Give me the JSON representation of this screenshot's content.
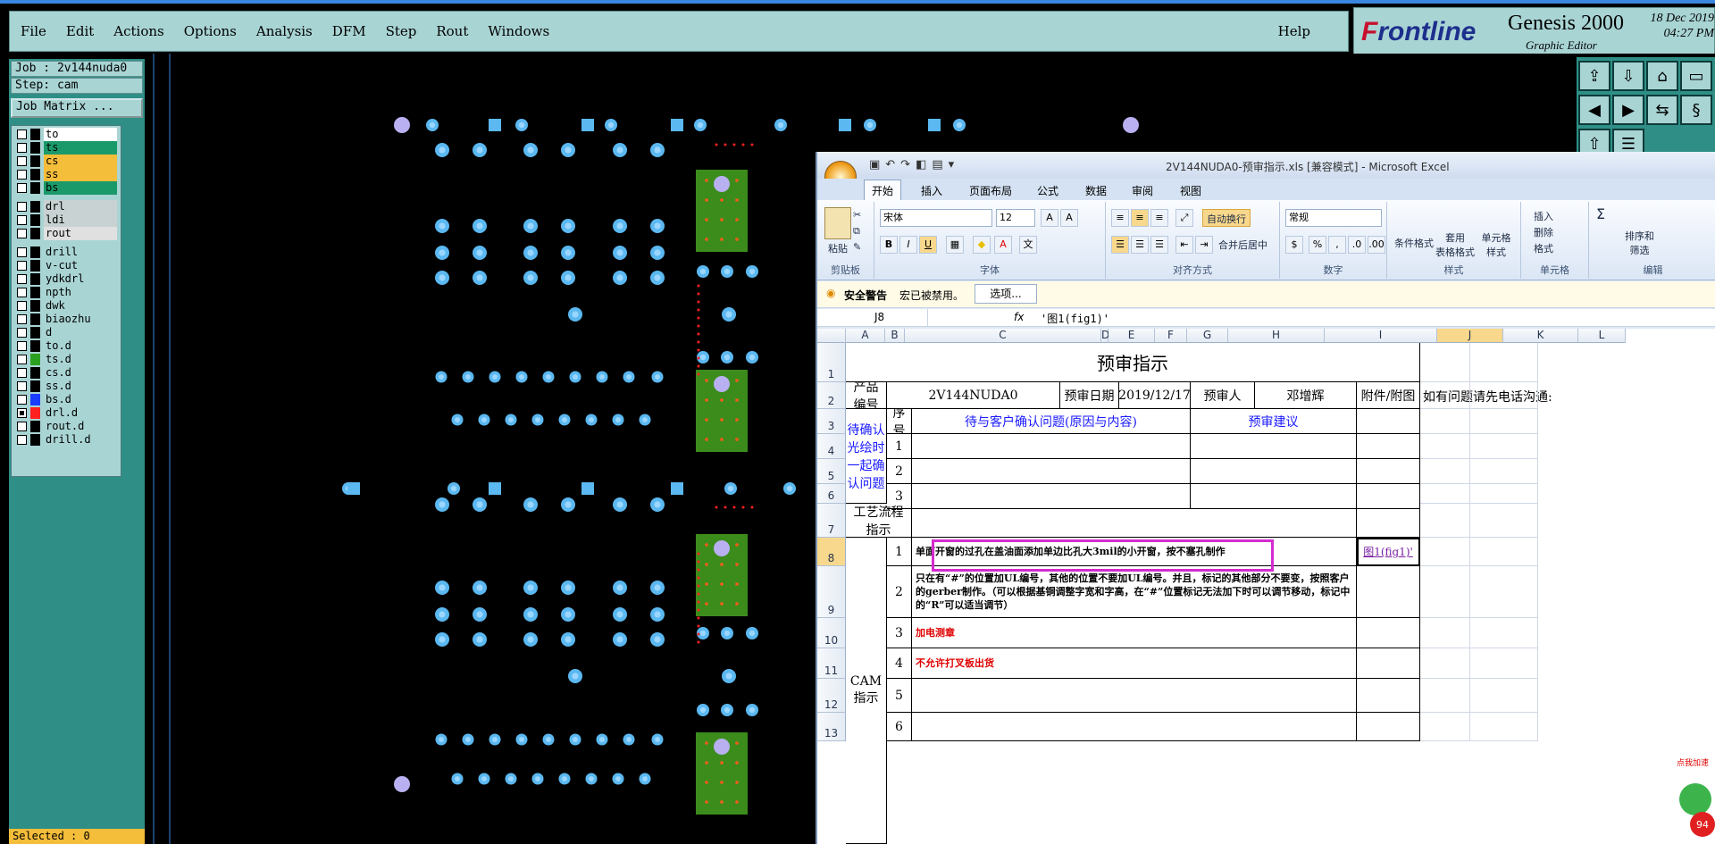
{
  "menu": [
    "File",
    "Edit",
    "Actions",
    "Options",
    "Analysis",
    "DFM",
    "Step",
    "Rout",
    "Windows"
  ],
  "help": "Help",
  "brand": {
    "logo_a": "F",
    "logo_b": "rontline",
    "product": "Genesis 2000",
    "subtitle": "Graphic Editor",
    "date": "18 Dec 2019",
    "time": "04:27 PM"
  },
  "job": {
    "job_label": "Job : 2v144nuda0",
    "step_label": "Step: cam",
    "matrix_button": "Job Matrix ..."
  },
  "layers": [
    {
      "name": "to",
      "color": "#ffffff",
      "swatch": "#000000"
    },
    {
      "name": "ts",
      "color": "#1a9a6a",
      "swatch": "#000000"
    },
    {
      "name": "cs",
      "color": "#f4bd3a",
      "swatch": "#000000"
    },
    {
      "name": "ss",
      "color": "#f4bd3a",
      "swatch": "#000000"
    },
    {
      "name": "bs",
      "color": "#1a9a6a",
      "swatch": "#000000"
    },
    {
      "name": "drl",
      "color": "#c9d2d2",
      "swatch": "#000000"
    },
    {
      "name": "ldi",
      "color": "#c9d2d2",
      "swatch": "#000000"
    },
    {
      "name": "rout",
      "color": "#e0e0e0",
      "swatch": "#000000"
    },
    {
      "name": "drill",
      "color": "#a9d4d4",
      "swatch": "#000000"
    },
    {
      "name": "v-cut",
      "color": "#a9d4d4",
      "swatch": "#000000"
    },
    {
      "name": "ydkdrl",
      "color": "#a9d4d4",
      "swatch": "#000000"
    },
    {
      "name": "npth",
      "color": "#a9d4d4",
      "swatch": "#000000"
    },
    {
      "name": "dwk",
      "color": "#a9d4d4",
      "swatch": "#000000"
    },
    {
      "name": "biaozhu",
      "color": "#a9d4d4",
      "swatch": "#000000"
    },
    {
      "name": "d",
      "color": "#a9d4d4",
      "swatch": "#000000"
    },
    {
      "name": "to.d",
      "color": "#a9d4d4",
      "swatch": "#000000"
    },
    {
      "name": "ts.d",
      "color": "#a9d4d4",
      "swatch": "#2aa020"
    },
    {
      "name": "cs.d",
      "color": "#a9d4d4",
      "swatch": "#000000"
    },
    {
      "name": "ss.d",
      "color": "#a9d4d4",
      "swatch": "#000000"
    },
    {
      "name": "bs.d",
      "color": "#a9d4d4",
      "swatch": "#1a3cff"
    },
    {
      "name": "drl.d",
      "color": "#a9d4d4",
      "swatch": "#ff2020"
    },
    {
      "name": "rout.d",
      "color": "#a9d4d4",
      "swatch": "#000000"
    },
    {
      "name": "drill.d",
      "color": "#a9d4d4",
      "swatch": "#000000"
    }
  ],
  "selected": "Selected : 0",
  "excel": {
    "title": "2V144NUDA0-预审指示.xls [兼容模式] - Microsoft Excel",
    "tabs": [
      "开始",
      "插入",
      "页面布局",
      "公式",
      "数据",
      "审阅",
      "视图"
    ],
    "ribbon": {
      "paste": "粘贴",
      "clipboard": "剪贴板",
      "font_name": "宋体",
      "font_size": "12",
      "font": "字体",
      "wrap": "自动换行",
      "merge": "合并后居中",
      "alignment": "对齐方式",
      "num_format": "常规",
      "number": "数字",
      "cond_fmt": "条件格式",
      "table_fmt": "套用\n表格格式",
      "cell_style": "单元格\n样式",
      "styles": "样式",
      "insert": "插入",
      "delete": "删除",
      "format": "格式",
      "cells": "单元格",
      "sort": "排序和\n筛选",
      "editing": "编辑"
    },
    "security": {
      "label": "安全警告",
      "msg": "宏已被禁用。",
      "button": "选项..."
    },
    "namebox": "J8",
    "formula": "'图1(fig1)'",
    "columns": [
      "A",
      "B",
      "C",
      "D",
      "E",
      "F",
      "G",
      "H",
      "I",
      "J",
      "K",
      "L"
    ],
    "rows": [
      "1",
      "2",
      "3",
      "4",
      "5",
      "6",
      "7",
      "8",
      "9",
      "10",
      "11",
      "12",
      "13"
    ],
    "sheet": {
      "title": "预审指示",
      "product_no_label": "产品\n编号",
      "product_no": "2V144NUDA0",
      "date_label": "预审日期",
      "date": "2019/12/17",
      "reviewer_label": "预审人",
      "reviewer": "邓增辉",
      "attach_label": "附件/附图",
      "phone_note": "如有问题请先电话沟通:",
      "confirm_label": "待确认\n光绘时\n一起确\n认问题",
      "seq_label": "序号",
      "issues_label": "待与客户确认问题(原因与内容)",
      "suggest_label": "预审建议",
      "seq": [
        "1",
        "2",
        "3"
      ],
      "process_label": "工艺流程\n指示",
      "cam_label": "CAM\n指示",
      "cam_seq": [
        "1",
        "2",
        "3",
        "4",
        "5",
        "6"
      ],
      "cam_1": "单面开窗的过孔在盖油面添加单边比孔大3mil的小开窗，按不塞孔制作",
      "cam_2": "只在有“#”的位置加UL编号，其他的位置不要加UL编号。并且，标记的其他部分不要变，按照客户的gerber制作。（可以根据基铜调整字宽和字高，在“#”位置标记无法加下时可以调节移动，标记中的“R”可以适当调节）",
      "cam_3": "加电测章",
      "cam_4": "不允许打叉板出货",
      "fig_link": "图1(fig1)'"
    }
  },
  "mascot": {
    "label": "点我加速",
    "badge": "94"
  }
}
